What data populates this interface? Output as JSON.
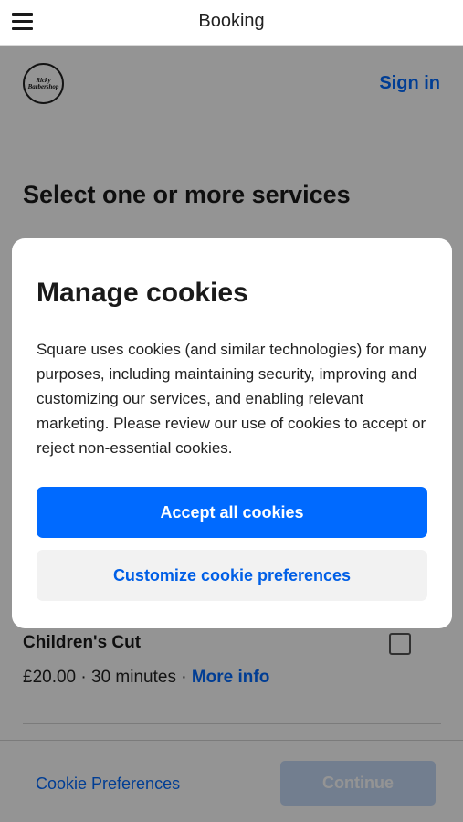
{
  "topbar": {
    "title": "Booking"
  },
  "header": {
    "logo_text": "Ricky Barbershop",
    "signin_label": "Sign in"
  },
  "main": {
    "section_title": "Select one or more services",
    "services": [
      {
        "name": "Children's Cut",
        "price": "£20.00",
        "duration": "30 minutes",
        "more_info": "More info"
      }
    ]
  },
  "footer": {
    "cookie_preferences_label": "Cookie Preferences",
    "continue_label": "Continue"
  },
  "modal": {
    "title": "Manage cookies",
    "body": "Square uses cookies (and similar technologies) for many purposes, including maintaining security, improving and customizing our services, and enabling relevant marketing. Please review our use of cookies to accept or reject non-essential cookies.",
    "accept_label": "Accept all cookies",
    "customize_label": "Customize cookie preferences"
  },
  "colors": {
    "accent": "#006aff",
    "overlay": "rgba(0,0,0,0.42)",
    "continue_disabled": "#c4d9f7"
  },
  "icons": [
    "hamburger-menu-icon",
    "logo",
    "checkbox"
  ]
}
